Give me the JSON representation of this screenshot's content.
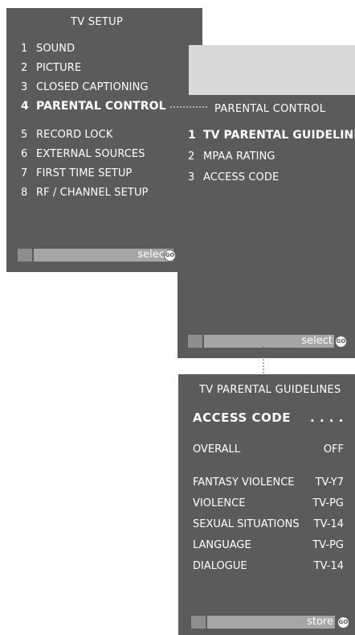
{
  "tv_setup": {
    "title": "TV  SETUP",
    "items": [
      {
        "num": "1",
        "label": "SOUND"
      },
      {
        "num": "2",
        "label": "PICTURE"
      },
      {
        "num": "3",
        "label": "CLOSED CAPTIONING"
      },
      {
        "num": "4",
        "label": "PARENTAL CONTROL"
      },
      {
        "num": "5",
        "label": "RECORD LOCK"
      },
      {
        "num": "6",
        "label": "EXTERNAL SOURCES"
      },
      {
        "num": "7",
        "label": "FIRST TIME SETUP"
      },
      {
        "num": "8",
        "label": "RF / CHANNEL SETUP"
      }
    ],
    "bar_label": "select",
    "go_label": "GO"
  },
  "parental_control": {
    "title": "PARENTAL CONTROL",
    "items": [
      {
        "num": "1",
        "label": "TV PARENTAL GUIDELINES"
      },
      {
        "num": "2",
        "label": "MPAA RATING"
      },
      {
        "num": "3",
        "label": "ACCESS CODE"
      }
    ],
    "bar_label": "select",
    "go_label": "GO"
  },
  "tv_parental_guidelines": {
    "title": "TV PARENTAL GUIDELINES",
    "access_code_label": "ACCESS  CODE",
    "access_code_value": ". . . .",
    "overall": {
      "label": "OVERALL",
      "value": "OFF"
    },
    "ratings": [
      {
        "label": "FANTASY VIOLENCE",
        "value": "TV-Y7"
      },
      {
        "label": "VIOLENCE",
        "value": "TV-PG"
      },
      {
        "label": "SEXUAL SITUATIONS",
        "value": "TV-14"
      },
      {
        "label": "LANGUAGE",
        "value": "TV-PG"
      },
      {
        "label": "DIALOGUE",
        "value": "TV-14"
      }
    ],
    "bar_label": "store",
    "go_label": "GO"
  },
  "colors": {
    "panel": "#5b5b5b",
    "bar": "#a6a6a6",
    "text": "#ffffff",
    "highlight": "#d9d9d9"
  }
}
